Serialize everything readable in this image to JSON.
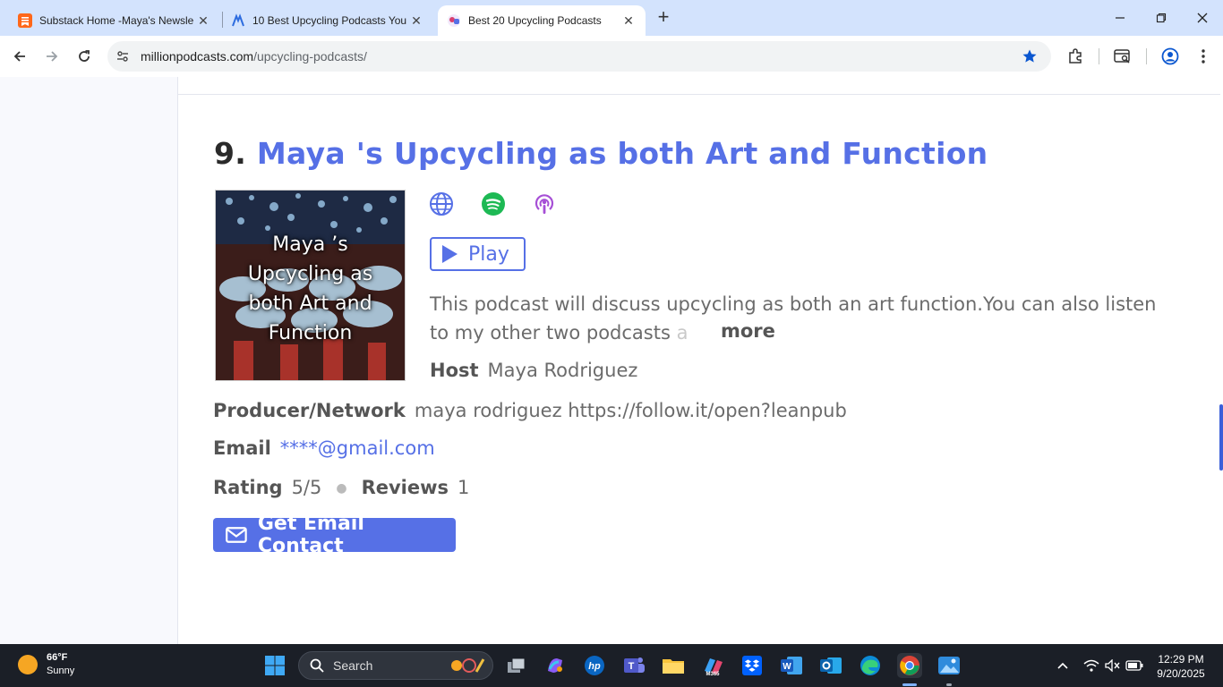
{
  "browser": {
    "tabs": [
      {
        "title": "Substack Home -Maya's Newsle",
        "active": false
      },
      {
        "title": "10 Best Upcycling Podcasts You",
        "active": false
      },
      {
        "title": "Best 20 Upcycling Podcasts",
        "active": true
      }
    ],
    "url_domain": "millionpodcasts.com",
    "url_path": "/upcycling-podcasts/"
  },
  "podcast": {
    "number": "9.",
    "title": "Maya 's Upcycling as both Art and Function",
    "cover_text": "Maya ’s Upcycling as both Art and Function",
    "play_label": "Play",
    "description_line1": "This podcast will discuss upcycling as both an art function.You can also listen",
    "description_line2": "to my other two podcasts ",
    "description_fade": "a",
    "more_label": "more",
    "host_label": "Host",
    "host_value": "Maya Rodriguez",
    "producer_label": "Producer/Network",
    "producer_value": "maya rodriguez https://follow.it/open?leanpub",
    "email_label": "Email",
    "email_value": "****@gmail.com",
    "rating_label": "Rating",
    "rating_value": "5/5",
    "reviews_label": "Reviews",
    "reviews_value": "1",
    "contact_button": "Get Email Contact"
  },
  "taskbar": {
    "weather_temp": "66°F",
    "weather_desc": "Sunny",
    "search_placeholder": "Search",
    "time": "12:29 PM",
    "date": "9/20/2025"
  },
  "colors": {
    "accent": "#5670e6",
    "spotify": "#1db954",
    "apple_podcasts": "#a64fd6"
  }
}
